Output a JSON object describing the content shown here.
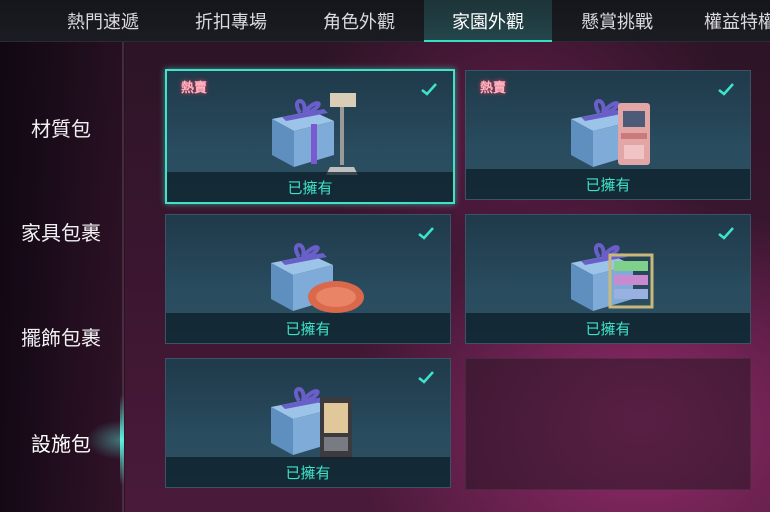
{
  "tabs": [
    {
      "label": "熱門速遞",
      "active": false
    },
    {
      "label": "折扣專場",
      "active": false
    },
    {
      "label": "角色外觀",
      "active": false
    },
    {
      "label": "家園外觀",
      "active": true
    },
    {
      "label": "懸賞挑戰",
      "active": false
    },
    {
      "label": "權益特權",
      "active": false
    }
  ],
  "sidebar": {
    "items": [
      {
        "label": "材質包",
        "active": false
      },
      {
        "label": "家具包裹",
        "active": false
      },
      {
        "label": "擺飾包裹",
        "active": false
      },
      {
        "label": "設施包",
        "active": true
      }
    ]
  },
  "items": [
    {
      "badge": "熱賣",
      "status": "已擁有",
      "owned": true,
      "selected": true,
      "prop": "lamp-icon"
    },
    {
      "badge": "熱賣",
      "status": "已擁有",
      "owned": true,
      "selected": false,
      "prop": "arcade-machine-icon"
    },
    {
      "badge": "",
      "status": "已擁有",
      "owned": true,
      "selected": false,
      "prop": "rug-icon"
    },
    {
      "badge": "",
      "status": "已擁有",
      "owned": true,
      "selected": false,
      "prop": "shelf-icon"
    },
    {
      "badge": "",
      "status": "已擁有",
      "owned": true,
      "selected": false,
      "prop": "vending-machine-icon"
    }
  ],
  "colors": {
    "accent": "#3fe3c8",
    "card": "#294c5f",
    "background": "#3a1630",
    "hot": "#ffb3c0"
  }
}
